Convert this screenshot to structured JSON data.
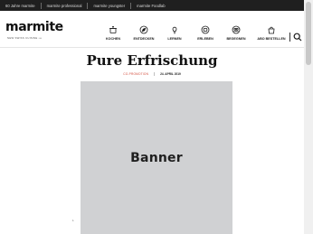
{
  "topbar": {
    "links": [
      "60 Jahre marmite",
      "marmite professional",
      "marmite youngster",
      "marmite Foodlab"
    ]
  },
  "header": {
    "logo": "marmite",
    "tagline": "NEW SWISS CUISINE •••",
    "nav": [
      {
        "label": "KOCHEN",
        "icon": "pot-icon"
      },
      {
        "label": "ENTDECKEN",
        "icon": "compass-icon"
      },
      {
        "label": "LERNEN",
        "icon": "lightbulb-icon"
      },
      {
        "label": "ERLEBEN",
        "icon": "ticket-icon"
      },
      {
        "label": "BEGEGNEN",
        "icon": "people-icon"
      },
      {
        "label": "ABO BESTELLEN",
        "icon": "bag-icon"
      }
    ]
  },
  "article": {
    "title": "Pure Erfrischung",
    "category": "CO-PROMOTION",
    "date": "24. APRIL 2019"
  },
  "banner": {
    "label": "Banner"
  },
  "side_number": "1"
}
